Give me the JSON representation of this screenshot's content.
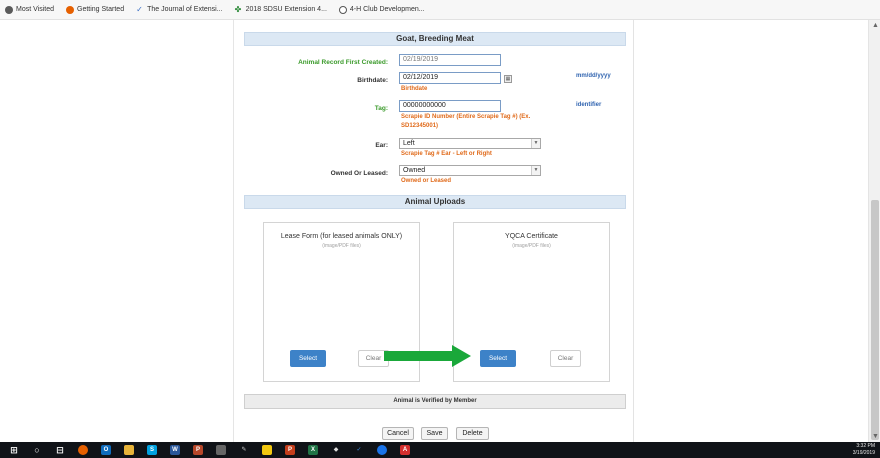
{
  "bookmarks": [
    {
      "label": "Most Visited",
      "icon": "gear-icon",
      "color": "#5a5a5a"
    },
    {
      "label": "Getting Started",
      "icon": "firefox-icon",
      "color": "#e66000"
    },
    {
      "label": "The Journal of Extensi...",
      "icon": "check-icon",
      "color": "#3b6fc4"
    },
    {
      "label": "2018 SDSU Extension 4...",
      "icon": "clover-icon",
      "color": "#2e8b3a"
    },
    {
      "label": "4-H Club Developmen...",
      "icon": "globe-icon",
      "color": "#555555"
    }
  ],
  "form": {
    "section_title": "Goat, Breeding Meat",
    "record_created_label": "Animal Record First Created:",
    "record_created_value": "02/19/2019",
    "birthdate_label": "Birthdate:",
    "birthdate_value": "02/12/2019",
    "birthdate_note": "Birthdate",
    "date_format": "mm/dd/yyyy",
    "tag_label": "Tag:",
    "tag_value": "00000000000",
    "tag_note_line1": "Scrapie ID Number (Entire Scrapie Tag #) (Ex.",
    "tag_note_line2": "SD12345001)",
    "tag_identifier": "identifier",
    "ear_label": "Ear:",
    "ear_value": "Left",
    "ear_note": "Scrapie Tag # Ear - Left or Right",
    "owned_label": "Owned Or Leased:",
    "owned_value": "Owned",
    "owned_note": "Owned or Leased"
  },
  "uploads": {
    "section_title": "Animal Uploads",
    "boxes": [
      {
        "title": "Lease Form (for leased animals ONLY)",
        "subtitle": "(image/PDF files)",
        "select_label": "Select",
        "clear_label": "Clear"
      },
      {
        "title": "YQCA Certificate",
        "subtitle": "(image/PDF files)",
        "select_label": "Select",
        "clear_label": "Clear"
      }
    ]
  },
  "verified_text": "Animal is Verified by Member",
  "footer_buttons": {
    "cancel": "Cancel",
    "save": "Save",
    "delete": "Delete"
  },
  "taskbar": {
    "time": "3:32 PM",
    "date": "3/19/2019"
  },
  "colors": {
    "accent_blue": "#3d82c8",
    "section_bg": "#dce8f4",
    "arrow_green": "#1aa83a",
    "label_green": "#3a9a2a",
    "note_orange": "#e06a1a"
  }
}
